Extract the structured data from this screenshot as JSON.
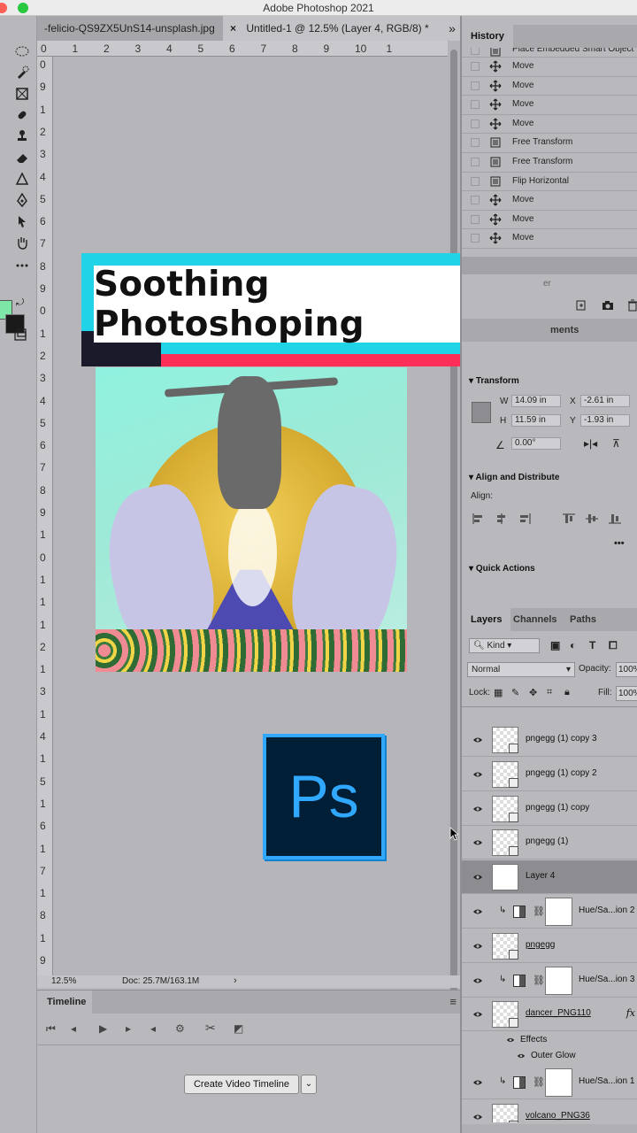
{
  "window": {
    "title": "Adobe Photoshop 2021"
  },
  "tabs": {
    "inactive": "-felicio-QS9ZX5UnS14-unsplash.jpg",
    "active": "Untitled-1 @ 12.5% (Layer 4, RGB/8) *",
    "close": "×",
    "overflow": "»"
  },
  "rulers": {
    "horizontal": [
      "0",
      "1",
      "2",
      "3",
      "4",
      "5",
      "6",
      "7",
      "8",
      "9",
      "10",
      "1"
    ],
    "vertical": [
      "0",
      "9",
      "1",
      "2",
      "3",
      "4",
      "5",
      "6",
      "7",
      "8",
      "9",
      "0",
      "1",
      "2",
      "3",
      "4",
      "5",
      "6",
      "7",
      "8",
      "9",
      "1",
      "0",
      "1",
      "1",
      "1",
      "2",
      "1",
      "3",
      "1",
      "4",
      "1",
      "5",
      "1",
      "6",
      "1",
      "7",
      "1",
      "8",
      "1",
      "9"
    ]
  },
  "banner": {
    "text": "Soothing Photoshoping"
  },
  "ps_logo": {
    "text": "Ps"
  },
  "status": {
    "zoom": "12.5%",
    "doc": "Doc: 25.7M/163.1M",
    "arrow": "›"
  },
  "timeline": {
    "tab": "Timeline",
    "menu": "≡",
    "create_button": "Create Video Timeline",
    "create_dropdown": "⌄"
  },
  "history": {
    "tab": "History",
    "items": [
      {
        "label": "Place Embedded Smart Object",
        "icon": "doc"
      },
      {
        "label": "Move",
        "icon": "move"
      },
      {
        "label": "Move",
        "icon": "move"
      },
      {
        "label": "Move",
        "icon": "move"
      },
      {
        "label": "Move",
        "icon": "move"
      },
      {
        "label": "Free Transform",
        "icon": "doc"
      },
      {
        "label": "Free Transform",
        "icon": "doc"
      },
      {
        "label": "Flip Horizontal",
        "icon": "doc"
      },
      {
        "label": "Move",
        "icon": "move"
      },
      {
        "label": "Move",
        "icon": "move"
      },
      {
        "label": "Move",
        "icon": "move"
      }
    ]
  },
  "properties": {
    "tab_partial_1": "er",
    "tab_partial_2": "ments",
    "transform_title": "Transform",
    "w_label": "W",
    "w_value": "14.09 in",
    "h_label": "H",
    "h_value": "11.59 in",
    "x_label": "X",
    "x_value": "-2.61 in",
    "y_label": "Y",
    "y_value": "-1.93 in",
    "angle_value": "0.00°",
    "align_title": "Align and Distribute",
    "align_label": "Align:",
    "more": "•••",
    "quick_title": "Quick Actions"
  },
  "layers_panel": {
    "tabs": [
      "Layers",
      "Channels",
      "Paths"
    ],
    "kind": "Kind",
    "blend_mode": "Normal",
    "opacity_label": "Opacity:",
    "opacity_value": "100%",
    "lock_label": "Lock:",
    "fill_label": "Fill:",
    "fill_value": "100%",
    "layers": [
      {
        "name": "pngegg (1) copy 3",
        "kind": "smart"
      },
      {
        "name": "pngegg (1) copy 2",
        "kind": "smart"
      },
      {
        "name": "pngegg (1) copy",
        "kind": "smart"
      },
      {
        "name": "pngegg (1)",
        "kind": "smart"
      },
      {
        "name": "Layer 4",
        "kind": "pixel",
        "selected": true
      },
      {
        "name": "Hue/Sa...ion 2",
        "kind": "adjustment"
      },
      {
        "name": "pngegg",
        "kind": "smart-underline"
      },
      {
        "name": "Hue/Sa...ion 3",
        "kind": "adjustment"
      },
      {
        "name": "dancer_PNG110",
        "kind": "smart-fx"
      },
      {
        "name": "Hue/Sa...ion 1",
        "kind": "adjustment"
      },
      {
        "name": "volcano_PNG36",
        "kind": "smart-underline"
      }
    ],
    "effects_label": "Effects",
    "outer_glow": "Outer Glow",
    "fx": "fx"
  }
}
